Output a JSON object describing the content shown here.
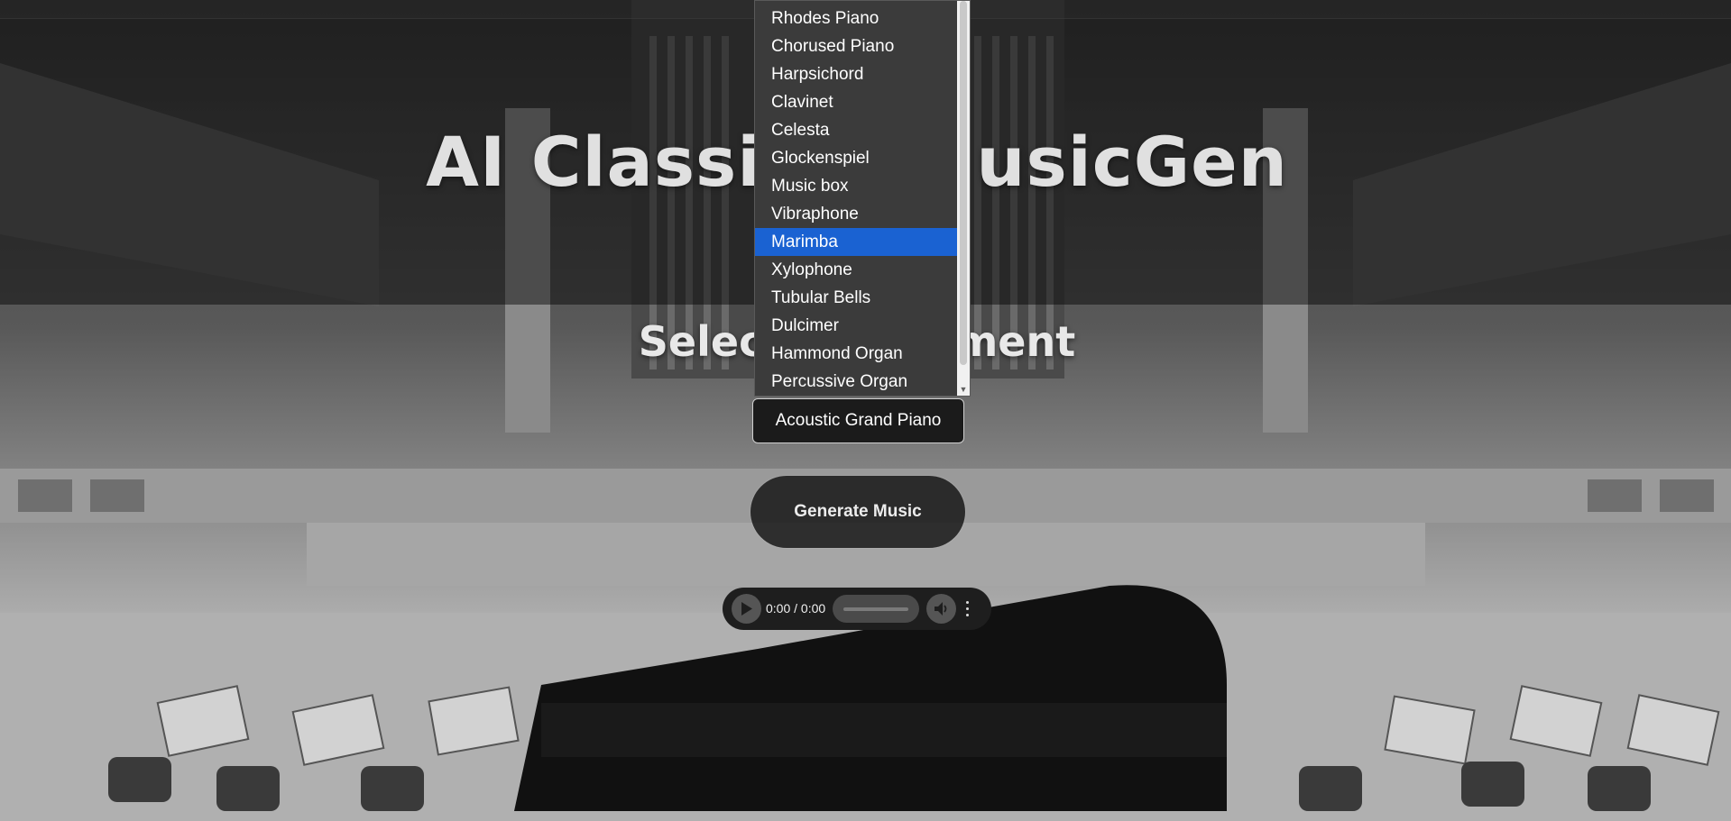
{
  "page": {
    "title_left": "AI Classi",
    "title_right": "usicGen",
    "section_left": "Select",
    "section_right": "ment"
  },
  "instrument_dropdown": {
    "options": [
      "Rhodes Piano",
      "Chorused Piano",
      "Harpsichord",
      "Clavinet",
      "Celesta",
      "Glockenspiel",
      "Music box",
      "Vibraphone",
      "Marimba",
      "Xylophone",
      "Tubular Bells",
      "Dulcimer",
      "Hammond Organ",
      "Percussive Organ"
    ],
    "highlighted_option": "Marimba",
    "selected_value": "Acoustic Grand Piano"
  },
  "generate": {
    "label": "Generate Music"
  },
  "audio_player": {
    "time": "0:00 / 0:00",
    "icons": {
      "play": "play-icon",
      "volume": "volume-icon",
      "more": "more-options-icon"
    }
  },
  "colors": {
    "highlight": "#1a62d2",
    "list_background": "#3b3b3b",
    "select_background": "#1b1b1b"
  }
}
